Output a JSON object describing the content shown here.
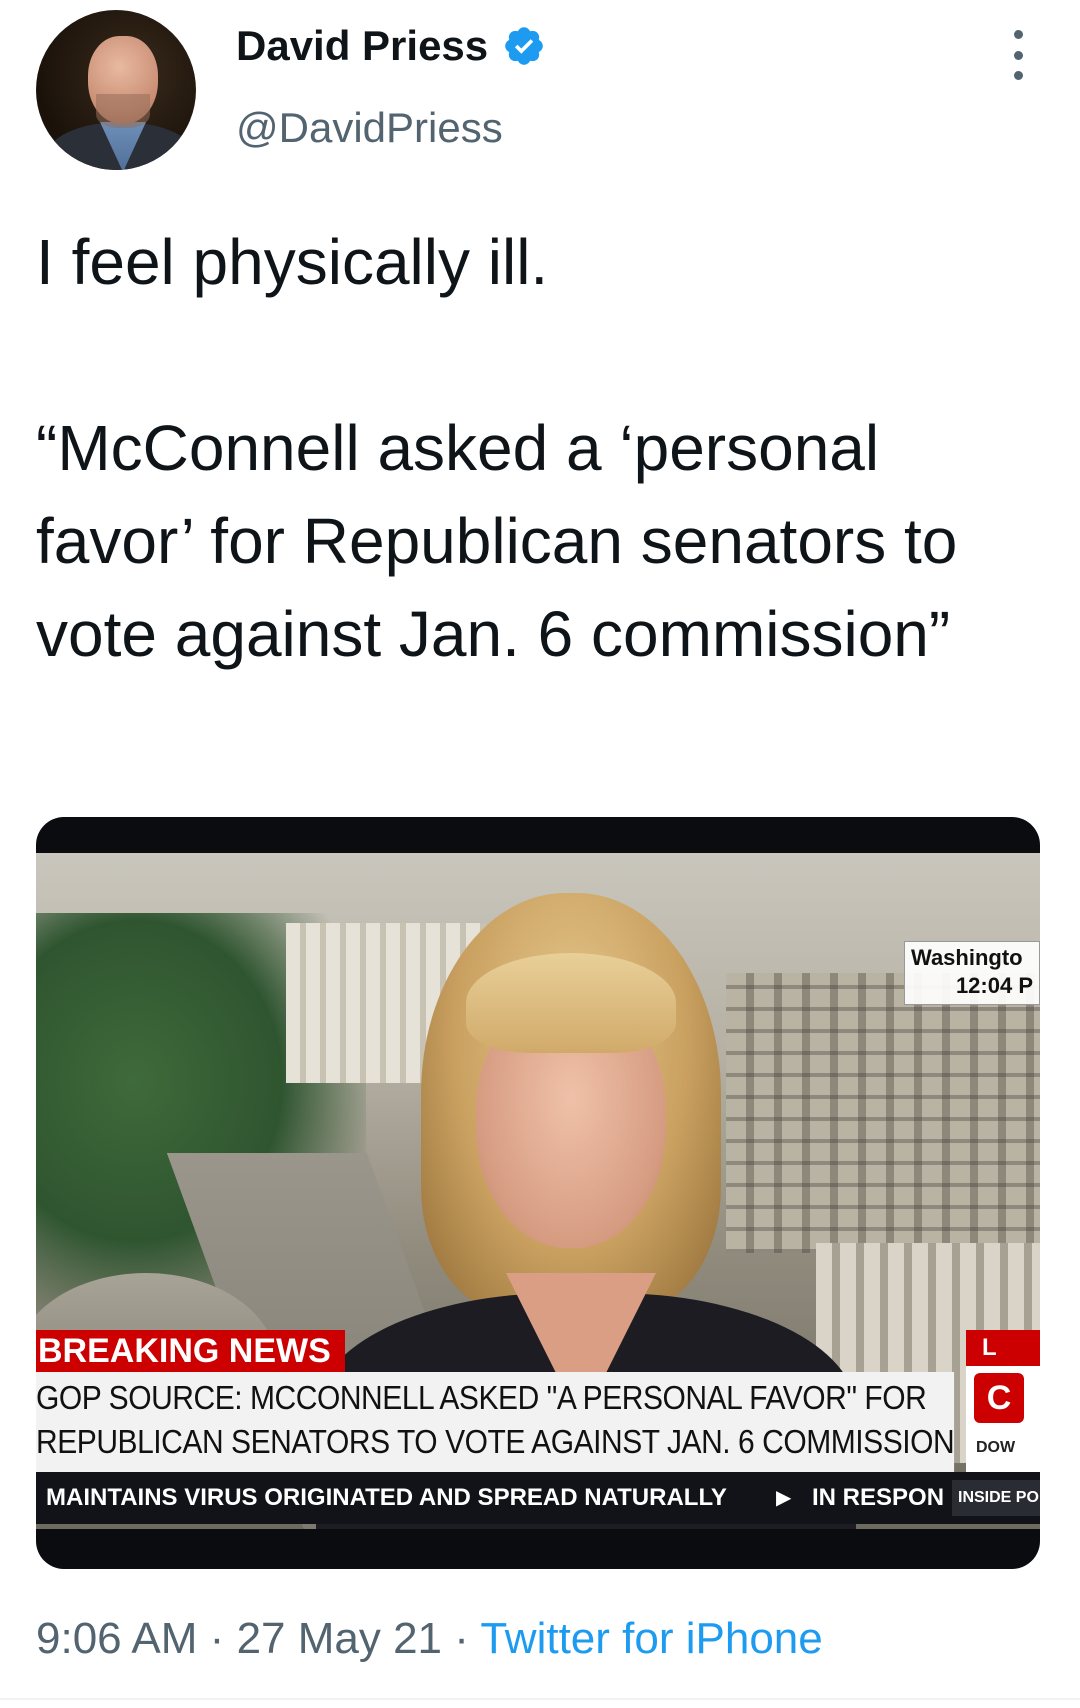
{
  "author": {
    "name": "David Priess",
    "handle": "@DavidPriess",
    "verified": true,
    "avatar_icon": "avatar-photo"
  },
  "tweet": {
    "text": "I feel physically ill.\n\n“McConnell asked a ‘personal favor’ for Republican senators to vote against Jan. 6 commission”"
  },
  "media": {
    "location": "Washingto",
    "time": "12:04 P",
    "breaking_label": "BREAKING NEWS",
    "headline_line1": "GOP SOURCE: MCCONNELL ASKED \"A PERSONAL FAVOR\" FOR",
    "headline_line2": "REPUBLICAN SENATORS TO VOTE AGAINST JAN. 6 COMMISSION",
    "live_label": "L",
    "network_logo": "C",
    "dow_label": "DOW",
    "ticker_text": "MAINTAINS VIRUS ORIGINATED AND SPREAD NATURALLY",
    "ticker_next": "IN RESPON",
    "ticker_badge": "INSIDE PO"
  },
  "meta": {
    "time": "9:06 AM",
    "separator": "·",
    "date": "27 May 21",
    "source": "Twitter for iPhone"
  },
  "colors": {
    "verified_blue": "#1d9bf0",
    "link_blue": "#1d9bf0",
    "secondary_text": "#536471",
    "cnn_red": "#cc0000"
  }
}
